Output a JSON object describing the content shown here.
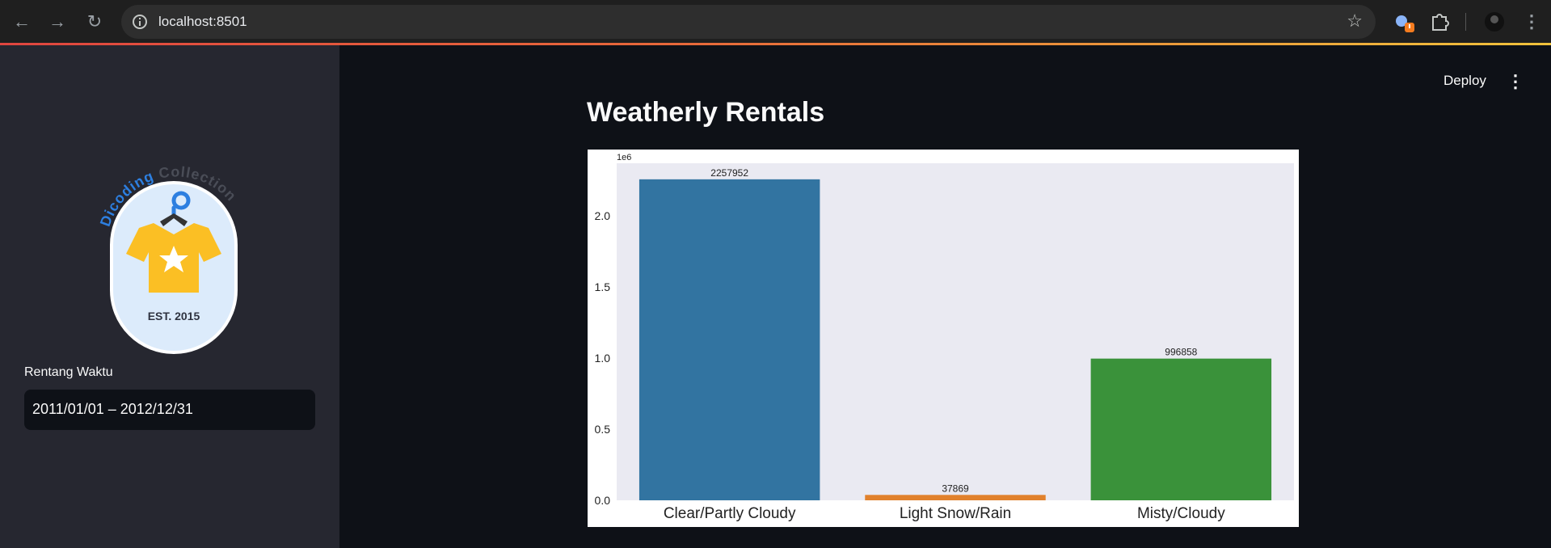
{
  "browser": {
    "url": "localhost:8501"
  },
  "sidebar": {
    "logo": {
      "arc_word1": "Dicoding",
      "arc_word2": "Collection",
      "badge_text": "EST. 2015"
    },
    "date_range": {
      "label": "Rentang Waktu",
      "value": "2011/01/01 – 2012/12/31"
    }
  },
  "header": {
    "deploy_label": "Deploy"
  },
  "main": {
    "title": "Weatherly Rentals"
  },
  "colors": {
    "bar1": "#3274a1",
    "bar2": "#e1812c",
    "bar3": "#3a923a",
    "plot_bg": "#eaeaf2"
  },
  "chart_data": {
    "type": "bar",
    "categories": [
      "Clear/Partly Cloudy",
      "Light Snow/Rain",
      "Misty/Cloudy"
    ],
    "values": [
      2257952,
      37869,
      996858
    ],
    "data_labels": [
      "2257952",
      "37869",
      "996858"
    ],
    "y_ticks": [
      "0.0",
      "0.5",
      "1.0",
      "1.5",
      "2.0"
    ],
    "y_tick_values": [
      0,
      500000,
      1000000,
      1500000,
      2000000
    ],
    "y_offset_label": "1e6",
    "ylim": [
      0,
      2370850
    ],
    "title": "",
    "xlabel": "",
    "ylabel": "",
    "grid": false
  }
}
